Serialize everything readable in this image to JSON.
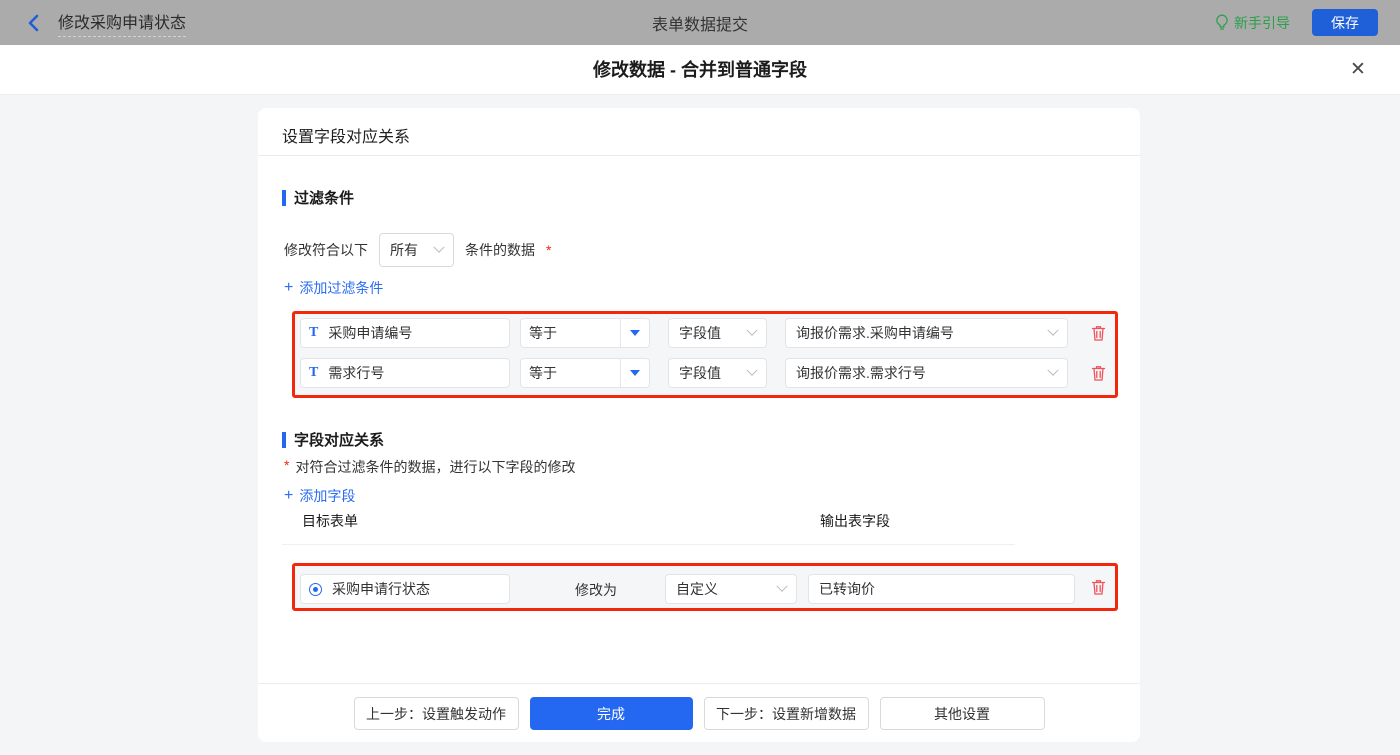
{
  "topbar": {
    "back_title": "修改采购申请状态",
    "center_title": "表单数据提交",
    "guide_label": "新手引导",
    "save_label": "保存"
  },
  "dialog": {
    "title": "修改数据 - 合并到普通字段"
  },
  "icons": {
    "plus": "+",
    "close": "✕",
    "text_field": "T"
  },
  "panel": {
    "header": "设置字段对应关系",
    "filter": {
      "title": "过滤条件",
      "match_prefix": "修改符合以下",
      "scope_value": "所有",
      "match_suffix": "条件的数据",
      "required_mark": "*",
      "add_label": "添加过滤条件",
      "rows": [
        {
          "field": "采购申请编号",
          "operator": "等于",
          "value_type": "字段值",
          "value": "询报价需求.采购申请编号"
        },
        {
          "field": "需求行号",
          "operator": "等于",
          "value_type": "字段值",
          "value": "询报价需求.需求行号"
        }
      ]
    },
    "mapping": {
      "title": "字段对应关系",
      "required_mark": "*",
      "description": "对符合过滤条件的数据，进行以下字段的修改",
      "add_label": "添加字段",
      "col_target": "目标表单",
      "col_output": "输出表字段",
      "rows": [
        {
          "field": "采购申请行状态",
          "action": "修改为",
          "value_type": "自定义",
          "value": "已转询价"
        }
      ]
    },
    "footer": {
      "prev_label": "上一步：设置触发动作",
      "done_label": "完成",
      "next_label": "下一步：设置新增数据",
      "other_label": "其他设置"
    }
  },
  "colors": {
    "accent_blue": "#2468f2",
    "topbar_save_blue": "#1f5fd8",
    "highlight_red": "#f2270c",
    "trash_red": "#f0515c",
    "guide_green": "#2aa04a",
    "topbar_gray": "#ababab"
  }
}
